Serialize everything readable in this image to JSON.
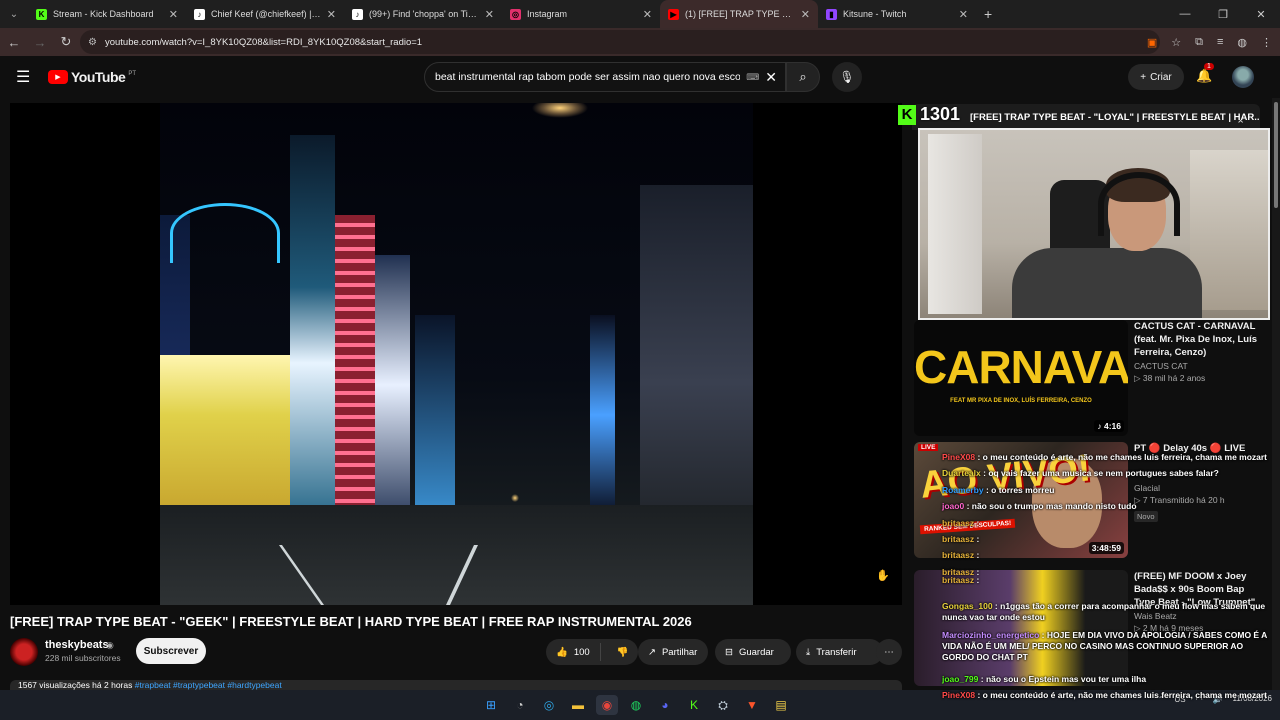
{
  "browser": {
    "tabs": [
      {
        "title": "Stream - Kick Dashboard",
        "icon": "kick-icon",
        "color": "#53fc18",
        "glyph": "K"
      },
      {
        "title": "Chief Keef (@chiefkeef) | TikTok",
        "icon": "tiktok-icon",
        "color": "#ffffff",
        "glyph": "♪"
      },
      {
        "title": "(99+) Find 'choppa' on TikTok | ...",
        "icon": "tiktok-icon",
        "color": "#ffffff",
        "glyph": "♪"
      },
      {
        "title": "Instagram",
        "icon": "instagram-icon",
        "color": "#e1306c",
        "glyph": "◎"
      },
      {
        "title": "(1) [FREE] TRAP TYPE BEAT - \"G...",
        "icon": "youtube-icon",
        "color": "#ff0000",
        "glyph": "▶"
      },
      {
        "title": "Kitsune - Twitch",
        "icon": "twitch-icon",
        "color": "#9146ff",
        "glyph": "▮"
      }
    ],
    "active_tab": 4,
    "url": "youtube.com/watch?v=I_8YK10QZ08&list=RDI_8YK10QZ08&start_radio=1"
  },
  "youtube": {
    "logo_text": "YouTube",
    "logo_country": "PT",
    "search_query": "beat instrumental rap tabom pode ser assim nao quero nova esco",
    "create_label": "Criar",
    "notif_count": "1"
  },
  "video": {
    "title": "[FREE] TRAP TYPE BEAT - \"GEEK\" | FREESTYLE BEAT | HARD TYPE BEAT | FREE RAP INSTRUMENTAL 2026",
    "channel": "theskybeats",
    "subscribers": "228 mil subscritores",
    "subscribe_label": "Subscrever",
    "likes": "100",
    "share_label": "Partilhar",
    "save_label": "Guardar",
    "download_label": "Transferir",
    "desc_peek": "1567 visualizações  há 2 horas",
    "desc_tags": "#trapbeat #traptypebeat #hardtypebeat"
  },
  "overlay": {
    "kick_viewers": "1301",
    "upnext_title": "[FREE] TRAP TYPE BEAT - \"LOYAL\" | FREESTYLE BEAT | HAR..."
  },
  "recommendations": [
    {
      "title": "CACTUS CAT - CARNAVAL (feat. Mr. Pixa De Inox, Luís Ferreira, Cenzo)",
      "channel": "CACTUS CAT",
      "meta": "▷ 38 mil  há 2 anos",
      "duration": "4:16",
      "thumb_text": "CARNAVAL",
      "thumb_sub": "FEAT MR PIXA DE INOX, LUÍS FERREIRA, CENZO"
    },
    {
      "title": "PT 🔴 Delay 40s 🔴 LIVE",
      "channel": "Glacial",
      "meta": "▷ 7  Transmitido há 20 h",
      "badge": "Novo",
      "duration": "3:48:59",
      "live_badge": "LIVE",
      "thumb_text": "AO VIVO!",
      "thumb_banner": "RANKED SEM DESCULPAS!"
    },
    {
      "title": "(FREE) MF DOOM x Joey Bada$$ x 90s Boom Bap Type Beat - \"Low Trumpet\"",
      "channel": "Wais Beatz",
      "meta": "▷ 2 M  há 9 meses"
    }
  ],
  "chat": [
    {
      "user": "PineX08",
      "user_color": "#ff4a4a",
      "text": "o meu conteúdo é arte, não me chames luis ferreira, chama me mozart"
    },
    {
      "user": "Duartealx",
      "user_color": "#e6d13a",
      "text": "oq vais fazer uma musica se nem portugues sabes falar?"
    },
    {
      "user": "Roamerby",
      "user_color": "#2f9bff",
      "text": "o torres morreu"
    },
    {
      "user": "joao0",
      "user_color": "#ff66cc",
      "text": "não sou o trumpo mas mando nisto tudo"
    },
    {
      "user": "britaasz",
      "user_color": "#e6b33a",
      "text": ""
    },
    {
      "user": "britaasz",
      "user_color": "#e6b33a",
      "text": ""
    },
    {
      "user": "britaasz",
      "user_color": "#e6b33a",
      "text": ""
    },
    {
      "user": "britaasz",
      "user_color": "#e6b33a",
      "text": ""
    },
    {
      "user": "britaasz",
      "user_color": "#e6b33a",
      "text": ""
    },
    {
      "user": "Gongas_100",
      "user_color": "#e6d13a",
      "text": "n1ggas tão a correr para acompanhar o meu flow mas sabem que nunca vao tar onde estou"
    },
    {
      "user": "Marciozinho_energetico",
      "user_color": "#c48cff",
      "text": "HOJE EM DIA VIVO DA APOLOGIA / SABES COMO É A VIDA NÃO É UM MEL/ PERCO NO CASINO MAS CONTINUO SUPERIOR AO GORDO DO CHAT PT"
    },
    {
      "user": "joao_799",
      "user_color": "#53fc18",
      "text": "não sou o Epstein mas vou ter uma ilha"
    },
    {
      "user": "PineX08",
      "user_color": "#ff4a4a",
      "text": "o meu conteúdo é arte, não me chames luis ferreira, chama me mozart"
    }
  ],
  "taskbar": {
    "lang": "US",
    "date": "11/08/2026",
    "apps": [
      "windows-icon",
      "search-icon",
      "edge-icon",
      "folder-icon",
      "chrome-icon",
      "spotify-icon",
      "discord-icon",
      "kick-icon",
      "steam-icon",
      "brave-icon",
      "notes-icon"
    ]
  }
}
